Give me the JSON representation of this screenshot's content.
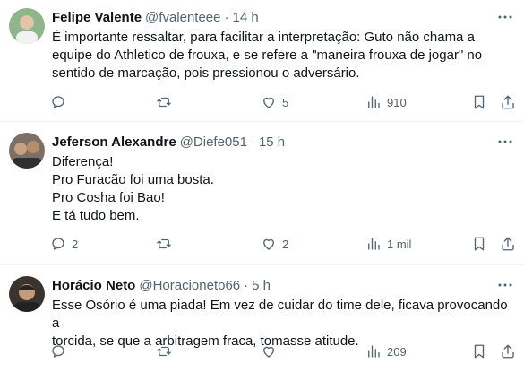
{
  "tweets": [
    {
      "name": "Felipe Valente",
      "handle": "@fvalenteee",
      "time": "14 h",
      "lines": [
        "É importante ressaltar, para facilitar a interpretação: Guto não chama a",
        "equipe do Athletico de frouxa, e se refere a \"maneira frouxa de jogar\" no",
        "sentido de marcação, pois pressionou o adversário."
      ],
      "replies": "",
      "retweets": "",
      "likes": "5",
      "views": "910"
    },
    {
      "name": "Jeferson Alexandre",
      "handle": "@Diefe051",
      "time": "15 h",
      "lines": [
        "Diferença!",
        "Pro Furacão foi uma bosta.",
        "Pro Cosha foi Bao!",
        "E tá tudo bem."
      ],
      "replies": "2",
      "retweets": "",
      "likes": "2",
      "views": "1 mil"
    },
    {
      "name": "Horácio Neto",
      "handle": "@Horacioneto66",
      "time": "5 h",
      "lines": [
        "Esse Osório é uma piada! Em vez de cuidar do time dele, ficava provocando a",
        "torcida, se que a arbitragem fraca, tomasse atitude."
      ],
      "replies": "",
      "retweets": "",
      "likes": "",
      "views": "209"
    }
  ],
  "colors": {
    "text": "#0f1419",
    "secondary": "#536471",
    "divider": "#eff3f4"
  },
  "icons": [
    "reply-icon",
    "retweet-icon",
    "like-icon",
    "views-icon",
    "bookmark-icon",
    "share-icon",
    "more-icon"
  ]
}
